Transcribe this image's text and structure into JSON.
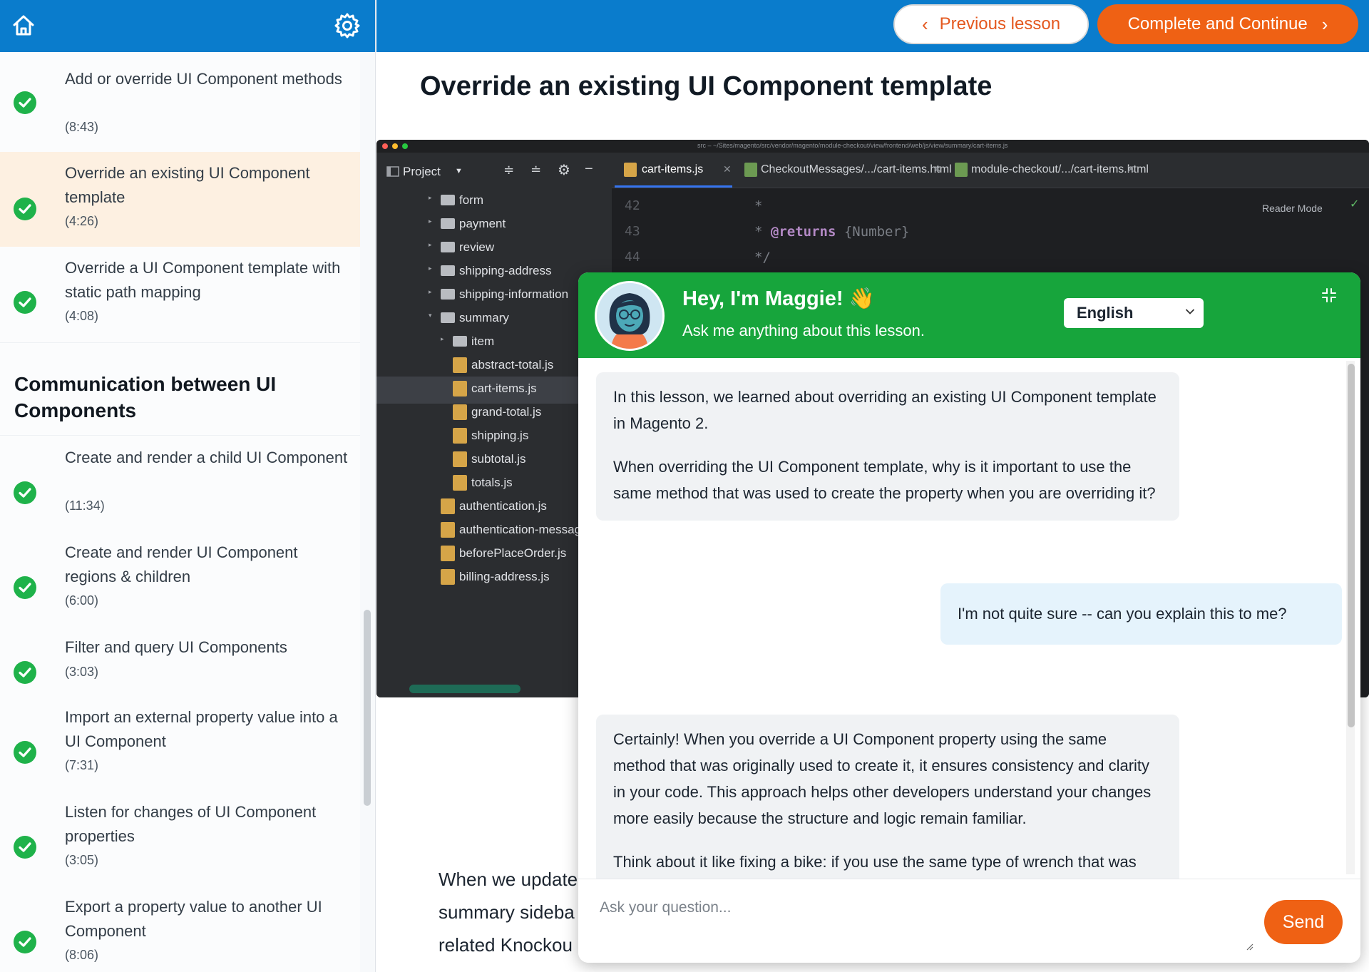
{
  "sidebar": {
    "lessons_top": [
      {
        "title": "Add or override UI Component methods",
        "duration": "(8:43)",
        "active": false
      },
      {
        "title": "Override an existing UI Component template",
        "duration": "(4:26)",
        "active": true
      },
      {
        "title": "Override a UI Component template with static path mapping",
        "duration": "(4:08)",
        "active": false
      }
    ],
    "section_heading": "Communication between UI Components",
    "lessons_bottom": [
      {
        "title": "Create and render a child UI Component",
        "duration": "(11:34)"
      },
      {
        "title": "Create and render UI Component regions & children",
        "duration": "(6:00)"
      },
      {
        "title": "Filter and query UI Components",
        "duration": "(3:03)"
      },
      {
        "title": "Import an external property value into a UI Component",
        "duration": "(7:31)"
      },
      {
        "title": "Listen for changes of UI Component properties",
        "duration": "(3:05)"
      },
      {
        "title": "Export a property value to another UI Component",
        "duration": "(8:06)"
      }
    ]
  },
  "topbar": {
    "previous_label": "Previous lesson",
    "next_label": "Complete and Continue"
  },
  "page_title": "Override an existing UI Component template",
  "ide": {
    "path": "src – ~/Sites/magento/src/vendor/magento/module-checkout/view/frontend/web/js/view/summary/cart-items.js",
    "project_label": "Project",
    "tabs": [
      "cart-items.js",
      "CheckoutMessages/.../cart-items.html",
      "module-checkout/.../cart-items.html"
    ],
    "reader_mode": "Reader Mode",
    "line_numbers": [
      "42",
      "43",
      "44"
    ],
    "code_lines": [
      "*",
      "@returns",
      "{Number}",
      "*/"
    ],
    "tree": [
      {
        "name": "form",
        "type": "folder"
      },
      {
        "name": "payment",
        "type": "folder"
      },
      {
        "name": "review",
        "type": "folder"
      },
      {
        "name": "shipping-address",
        "type": "folder"
      },
      {
        "name": "shipping-information",
        "type": "folder"
      },
      {
        "name": "summary",
        "type": "folder"
      },
      {
        "name": "item",
        "type": "folder"
      },
      {
        "name": "abstract-total.js",
        "type": "js"
      },
      {
        "name": "cart-items.js",
        "type": "js"
      },
      {
        "name": "grand-total.js",
        "type": "js"
      },
      {
        "name": "shipping.js",
        "type": "js"
      },
      {
        "name": "subtotal.js",
        "type": "js"
      },
      {
        "name": "totals.js",
        "type": "js"
      },
      {
        "name": "authentication.js",
        "type": "js"
      },
      {
        "name": "authentication-messages.js",
        "type": "js"
      },
      {
        "name": "beforePlaceOrder.js",
        "type": "js"
      },
      {
        "name": "billing-address.js",
        "type": "js"
      }
    ]
  },
  "body_text": [
    "When we update",
    "summary sideba",
    "related Knockou"
  ],
  "chat": {
    "title": "Hey, I'm Maggie! 👋",
    "subtitle": "Ask me anything about this lesson.",
    "language": "English",
    "messages": [
      {
        "role": "bot",
        "paragraphs": [
          "In this lesson, we learned about overriding an existing UI Component template in Magento 2.",
          "When overriding the UI Component template, why is it important to use the same method that was used to create the property when you are overriding it?"
        ]
      },
      {
        "role": "user",
        "paragraphs": [
          "I'm not quite sure -- can you explain this to me?"
        ]
      },
      {
        "role": "bot",
        "paragraphs": [
          "Certainly! When you override a UI Component property using the same method that was originally used to create it, it ensures consistency and clarity in your code. This approach helps other developers understand your changes more easily because the structure and logic remain familiar.",
          "Think about it like fixing a bike: if you use the same type of wrench that was originally used to assemble the bike, it's easier to make adjustments."
        ]
      }
    ],
    "input_placeholder": "Ask your question...",
    "send_label": "Send"
  },
  "colors": {
    "brand_blue": "#0a7ccc",
    "accent_orange": "#ef6114",
    "chat_green": "#17a53c",
    "check_green": "#1fb24a",
    "active_lesson_bg": "#fdf0e1"
  }
}
